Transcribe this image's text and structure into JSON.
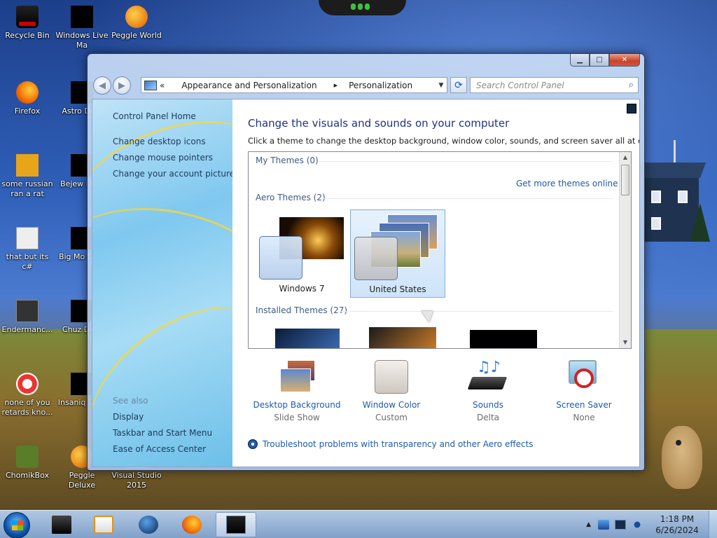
{
  "desktop": {
    "icons": [
      {
        "label": "Recycle Bin"
      },
      {
        "label": "Windows Live Ma"
      },
      {
        "label": "Peggle World"
      },
      {
        "label": "Firefox"
      },
      {
        "label": "Astro Delu"
      },
      {
        "label": "some russian ran a rat"
      },
      {
        "label": "Bejew Delu"
      },
      {
        "label": "that but its c#"
      },
      {
        "label": "Big Mo Delu"
      },
      {
        "label": "Endermanc..."
      },
      {
        "label": "Chuz Delu"
      },
      {
        "label": "none of you retards kno..."
      },
      {
        "label": "Insaniq Delu"
      },
      {
        "label": "ChomikBox"
      },
      {
        "label": "Peggle Deluxe"
      },
      {
        "label": "Visual Studio 2015"
      }
    ]
  },
  "window": {
    "caption": {
      "minimize": "▁",
      "maximize": "□",
      "close": "✕"
    },
    "nav": {
      "back": "◀",
      "forward": "▶"
    },
    "address": {
      "prefix": "«",
      "crumb1": "Appearance and Personalization",
      "sep1": "▸",
      "crumb2": "Personalization",
      "dropdown": "▼"
    },
    "refresh": "⟳",
    "search": {
      "placeholder": "Search Control Panel",
      "icon": "⌕"
    },
    "left_pane": {
      "home": "Control Panel Home",
      "links": [
        "Change desktop icons",
        "Change mouse pointers",
        "Change your account picture"
      ],
      "see_also_heading": "See also",
      "see_also": [
        "Display",
        "Taskbar and Start Menu",
        "Ease of Access Center"
      ]
    },
    "main": {
      "title": "Change the visuals and sounds on your computer",
      "subtitle": "Click a theme to change the desktop background, window color, sounds, and screen saver all at once.",
      "groups": {
        "my_themes": "My Themes (0)",
        "get_more": "Get more themes online",
        "aero_themes": "Aero Themes (2)",
        "installed_themes": "Installed Themes (27)"
      },
      "themes": [
        {
          "name": "Windows 7",
          "selected": false
        },
        {
          "name": "United States",
          "selected": true
        }
      ],
      "scroll": {
        "up": "▲",
        "down": "▼"
      },
      "bottom": [
        {
          "label": "Desktop Background",
          "value": "Slide Show"
        },
        {
          "label": "Window Color",
          "value": "Custom"
        },
        {
          "label": "Sounds",
          "value": "Delta"
        },
        {
          "label": "Screen Saver",
          "value": "None"
        }
      ],
      "troubleshoot": "Troubleshoot problems with transparency and other Aero effects"
    }
  },
  "taskbar": {
    "tray_arrow": "▲",
    "time": "1:18 PM",
    "date": "6/26/2024"
  }
}
